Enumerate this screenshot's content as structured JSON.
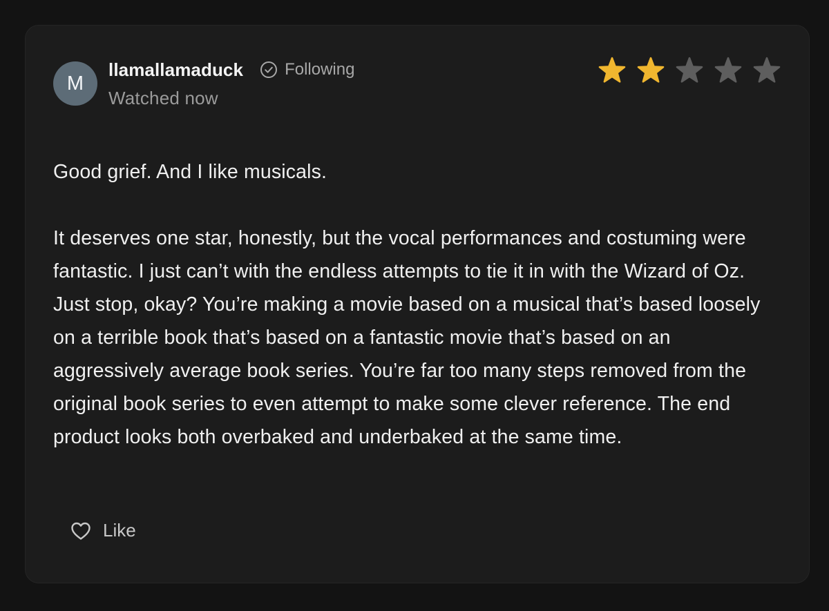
{
  "review": {
    "avatar_initial": "M",
    "username": "llamallamaduck",
    "follow_status": "Following",
    "timestamp": "Watched now",
    "rating": {
      "value": 2,
      "max": 5,
      "filled_color": "#f0b62f",
      "empty_color": "#5e5e5e"
    },
    "paragraphs": [
      "Good grief. And I like musicals.",
      "It deserves one star, honestly, but the vocal performances and costuming were fantastic. I just can’t with the endless attempts to tie it in with the Wizard of Oz. Just stop, okay? You’re making a movie based on a musical that’s based loosely on a terrible book that’s based on a fantastic movie that’s based on an aggressively average book series. You’re far too many steps removed from the original book series to even attempt to make some clever reference. The end product looks both overbaked and underbaked at the same time."
    ],
    "like_label": "Like",
    "icons": {
      "follow": "check-circle-icon",
      "star": "star-icon",
      "like": "heart-icon"
    }
  }
}
